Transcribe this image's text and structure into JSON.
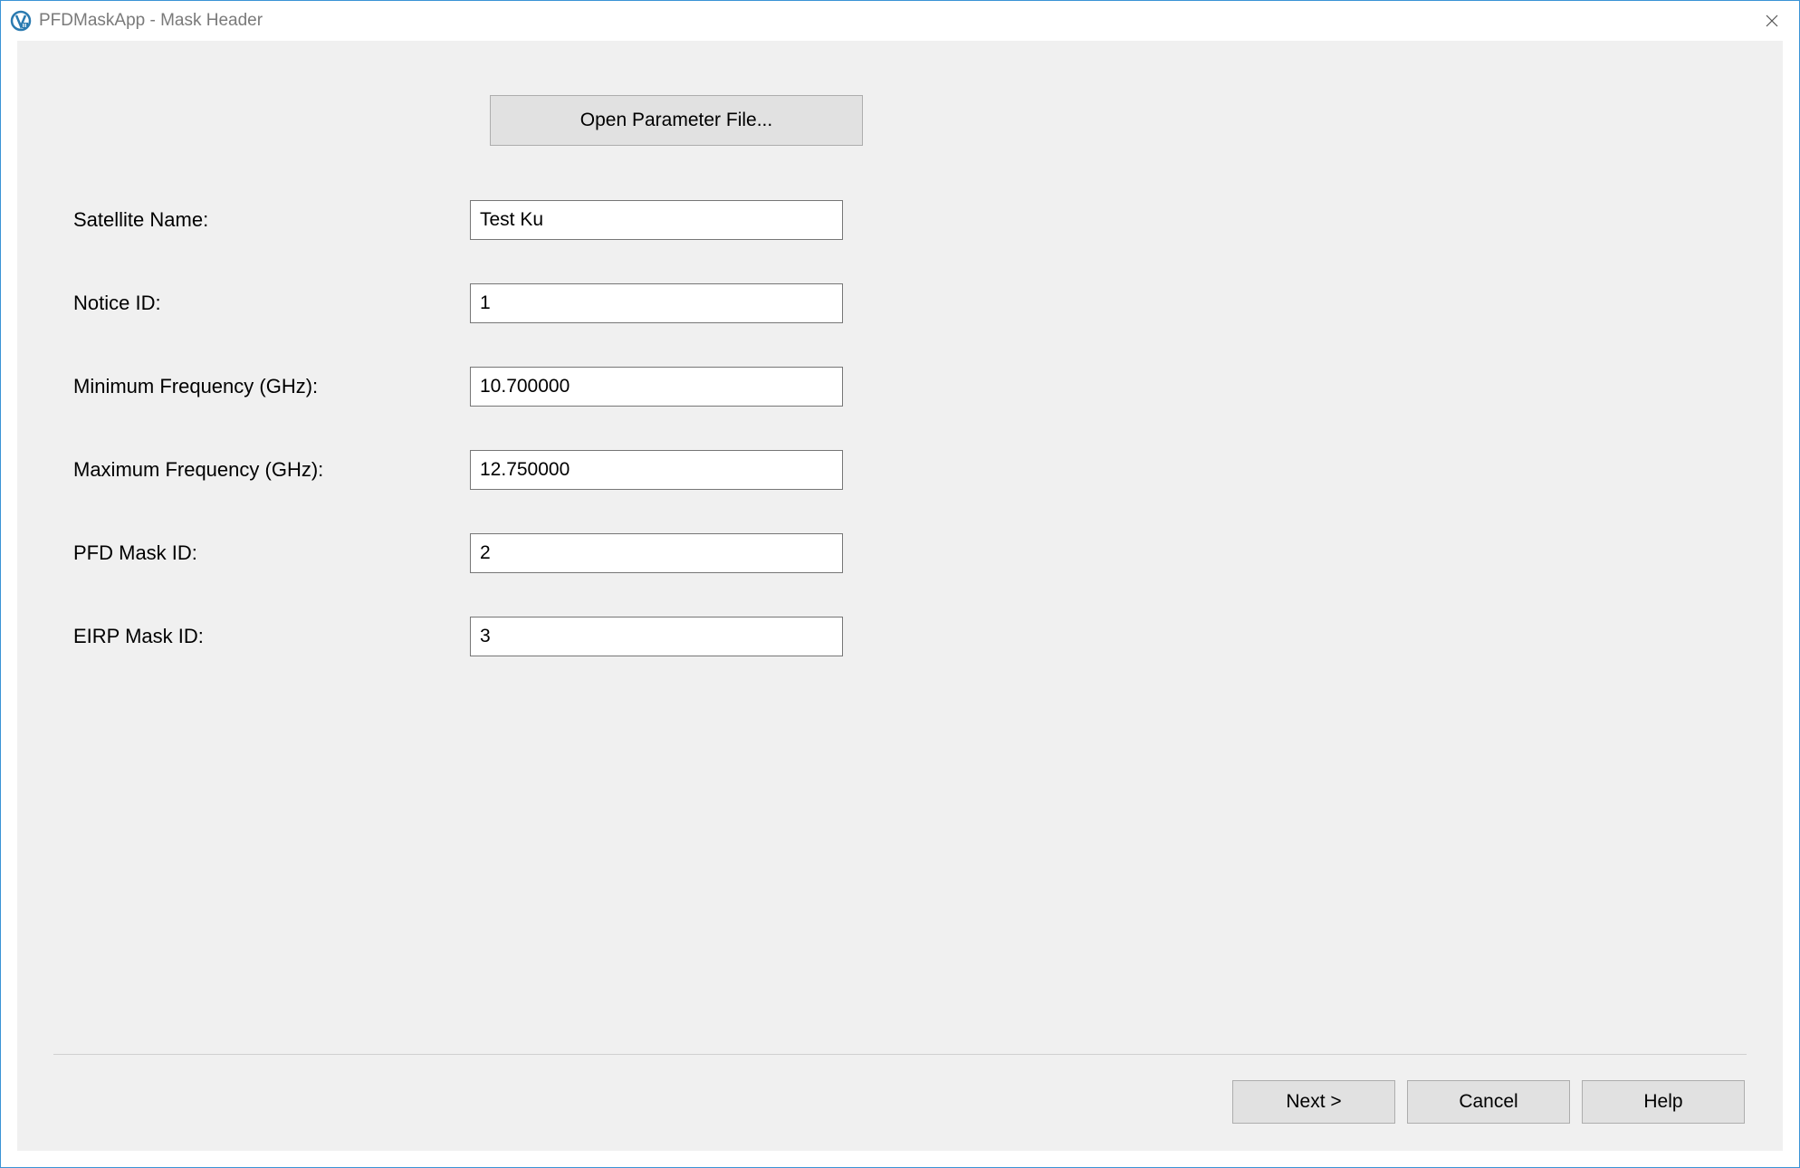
{
  "window": {
    "title": "PFDMaskApp - Mask Header"
  },
  "buttons": {
    "open_param": "Open Parameter File...",
    "next": "Next >",
    "cancel": "Cancel",
    "help": "Help"
  },
  "form": {
    "satellite_name": {
      "label": "Satellite Name:",
      "value": "Test Ku"
    },
    "notice_id": {
      "label": "Notice ID:",
      "value": "1"
    },
    "min_freq": {
      "label": "Minimum Frequency (GHz):",
      "value": "10.700000"
    },
    "max_freq": {
      "label": "Maximum Frequency (GHz):",
      "value": "12.750000"
    },
    "pfd_mask_id": {
      "label": "PFD Mask ID:",
      "value": "2"
    },
    "eirp_mask_id": {
      "label": "EIRP Mask ID:",
      "value": "3"
    }
  }
}
